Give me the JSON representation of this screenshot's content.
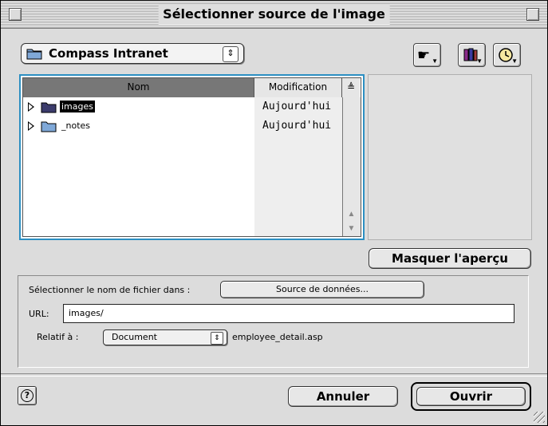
{
  "window": {
    "title": "Sélectionner source de l'image"
  },
  "location": {
    "selected": "Compass Intranet",
    "icon": "folder-icon"
  },
  "toolbar": {
    "buttons": [
      {
        "name": "shortcuts-button",
        "icon": "pointing-hand-icon"
      },
      {
        "name": "favorites-button",
        "icon": "books-icon"
      },
      {
        "name": "recent-button",
        "icon": "clock-icon"
      }
    ]
  },
  "file_list": {
    "columns": {
      "name": "Nom",
      "modified": "Modification"
    },
    "rows": [
      {
        "name": "images",
        "modified": "Aujourd'hui",
        "selected": true
      },
      {
        "name": "_notes",
        "modified": "Aujourd'hui",
        "selected": false
      }
    ]
  },
  "preview": {
    "toggle_label": "Masquer l'aperçu"
  },
  "options": {
    "select_filename_label": "Sélectionner le nom de fichier dans :",
    "datasource_button": "Source de données...",
    "url_label": "URL:",
    "url_value": "images/",
    "relative_label": "Relatif à :",
    "relative_value": "Document",
    "relative_file": "employee_detail.asp"
  },
  "footer": {
    "cancel_label": "Annuler",
    "open_label": "Ouvrir"
  },
  "colors": {
    "list_focus_ring": "#2c8fc2",
    "window_bg": "#dcdcdc",
    "name_header_bg": "#777777"
  }
}
